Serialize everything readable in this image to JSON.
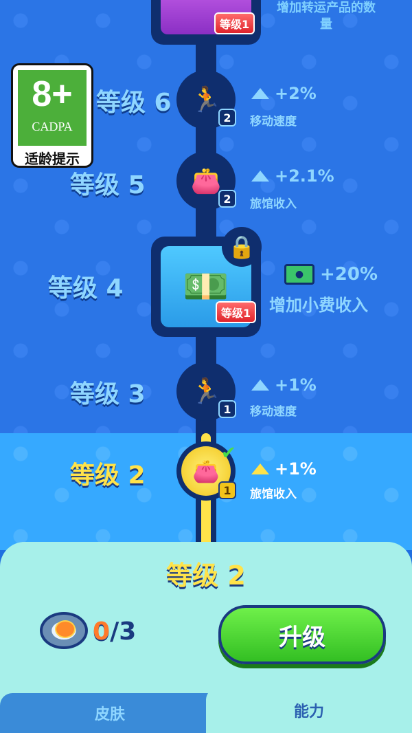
{
  "top_card": {
    "badge": "等级1",
    "description": "增加转运产品的数量"
  },
  "rating": {
    "age": "8+",
    "org": "CADPA",
    "text": "适龄提示"
  },
  "levels": [
    {
      "label": "等级 6",
      "icon": "running-icon",
      "count": "2",
      "value": "+2%",
      "stat": "移动速度"
    },
    {
      "label": "等级 5",
      "icon": "wallet-icon",
      "count": "2",
      "value": "+2.1%",
      "stat": "旅馆收入"
    },
    {
      "label": "等级 4",
      "icon": "money-hand-icon",
      "badge": "等级1",
      "value": "+20%",
      "stat": "增加小费收入",
      "locked": true
    },
    {
      "label": "等级 3",
      "icon": "running-icon",
      "count": "1",
      "value": "+1%",
      "stat": "移动速度"
    },
    {
      "label": "等级 2",
      "icon": "wallet-icon",
      "count": "1",
      "value": "+1%",
      "stat": "旅馆收入",
      "completed": true
    }
  ],
  "panel": {
    "title": "等级 2",
    "progress_current": "0",
    "progress_sep": "/",
    "progress_max": "3",
    "upgrade_label": "升级"
  },
  "tabs": {
    "skin": "皮肤",
    "ability": "能力"
  },
  "colors": {
    "accent": "#ffe34a",
    "track": "#0f2e6e",
    "button": "#33bf23"
  }
}
